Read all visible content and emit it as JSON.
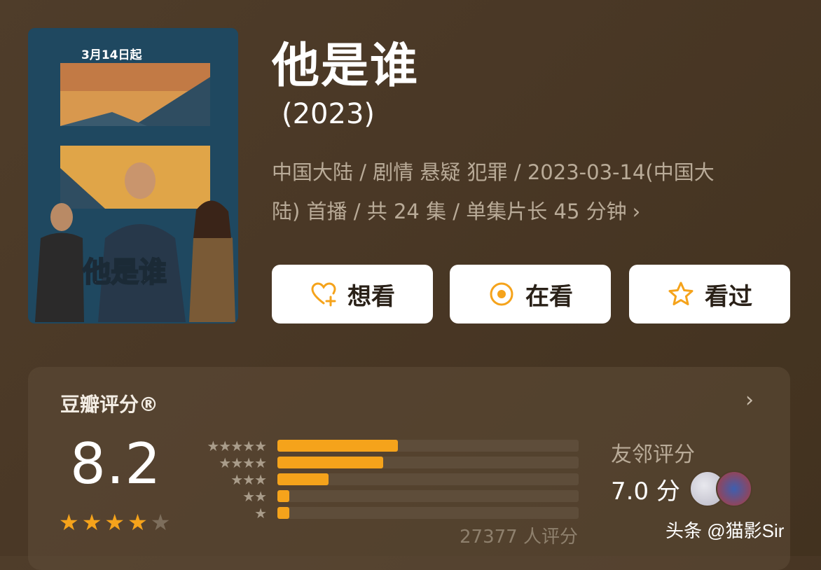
{
  "poster": {
    "date_text": "3月14日起",
    "title_art": "他是谁"
  },
  "title": "他是谁",
  "year": "(2023)",
  "meta": {
    "line1": "中国大陆 / 剧情 悬疑 犯罪 / 2023-03-14(中国大",
    "line2": "陆) 首播 / 共 24 集 / 单集片长 45 分钟",
    "chevron": "›"
  },
  "actions": {
    "want": "想看",
    "watching": "在看",
    "watched": "看过"
  },
  "rating": {
    "title": "豆瓣评分®",
    "chevron": "›",
    "score": "8.2",
    "stars": 4,
    "distribution": [
      {
        "stars": 5,
        "fraction": 0.4
      },
      {
        "stars": 4,
        "fraction": 0.35
      },
      {
        "stars": 3,
        "fraction": 0.17
      },
      {
        "stars": 2,
        "fraction": 0.04
      },
      {
        "stars": 1,
        "fraction": 0.04
      }
    ],
    "count": "27377 人评分",
    "friends_label": "友邻评分",
    "friends_score": "7.0 分"
  },
  "watermark": "头条 @猫影Sir",
  "colors": {
    "accent": "#f5a31b",
    "background": "#4a3826"
  }
}
